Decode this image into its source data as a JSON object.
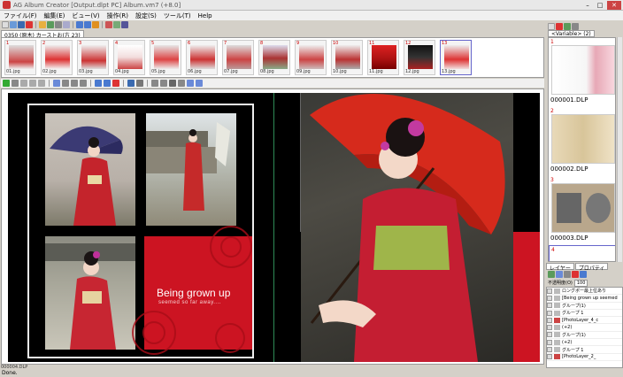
{
  "window": {
    "title": "AG Album Creator [Output.dlpt PC]  Album.vm7 (+8.0]",
    "minimize": "–",
    "maximize": "□",
    "close": "✕"
  },
  "menu": [
    "ファイル(F)",
    "編集(E)",
    "ビュー(V)",
    "操作(R)",
    "設定(S)",
    "ツール(T)",
    "Help"
  ],
  "file_tab": "0350 (原木) カーストお(方 23)",
  "filmstrip": [
    {
      "num": "1",
      "caption": "01.jpg"
    },
    {
      "num": "2",
      "caption": "02.jpg"
    },
    {
      "num": "3",
      "caption": "03.jpg"
    },
    {
      "num": "4",
      "caption": "04.jpg"
    },
    {
      "num": "5",
      "caption": "05.jpg"
    },
    {
      "num": "6",
      "caption": "06.jpg"
    },
    {
      "num": "7",
      "caption": "07.jpg"
    },
    {
      "num": "8",
      "caption": "08.jpg"
    },
    {
      "num": "9",
      "caption": "09.jpg"
    },
    {
      "num": "10",
      "caption": "10.jpg"
    },
    {
      "num": "11",
      "caption": "11.jpg"
    },
    {
      "num": "12",
      "caption": "12.jpg"
    },
    {
      "num": "13",
      "caption": "13.jpg"
    }
  ],
  "spread": {
    "caption_main": "Being grown up",
    "caption_sub": "seemed so far away...."
  },
  "status_page": "000004.DLP",
  "bottom_status": "Done.",
  "right_panel": {
    "tab": "<Variable> (2)",
    "pages": [
      {
        "num": "1",
        "label": "000001.DLP"
      },
      {
        "num": "2",
        "label": "000002.DLP"
      },
      {
        "num": "3",
        "label": "000003.DLP"
      },
      {
        "num": "4",
        "label": ""
      }
    ]
  },
  "layer_panel": {
    "tabs": [
      "レイヤー",
      "プロパティ"
    ],
    "opacity_label": "不透明度(O)",
    "opacity_value": "100",
    "layers": [
      "ロングポー最上位あり",
      "[Being grown up seemed",
      "グループ(1)",
      "グループ 1",
      "[PhotoLayer_4_c",
      "(+2)",
      "グループ(1)",
      "(+2)",
      "グループ 1",
      "[PhotoLayer_2_"
    ]
  },
  "colors": {
    "accent_red": "#cc1422",
    "canvas_black": "#000000",
    "selection_blue": "#6666cc"
  }
}
